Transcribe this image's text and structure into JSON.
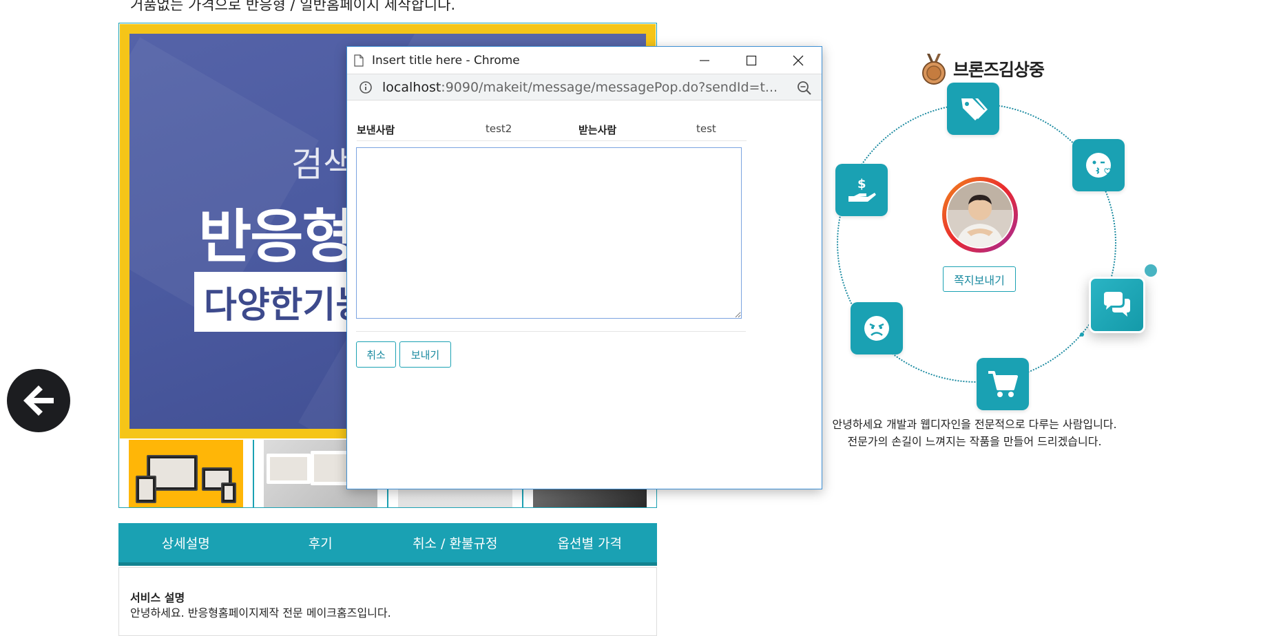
{
  "page": {
    "top_text": "거품없는 가격으로 반응형 / 일반홈페이지 제작합니다.",
    "hero": {
      "line1": "검색",
      "line2": "반응형",
      "line3": "다양한기능"
    },
    "nav": [
      "상세설명",
      "후기",
      "취소 / 환불규정",
      "옵션별 가격"
    ],
    "service_title": "서비스 설명",
    "service_text": "안녕하세요. 반응형홈페이지제작 전문 메이크홈즈입니다."
  },
  "profile": {
    "seller_name": "브론즈김상중",
    "send_message_label": "쪽지보내기",
    "intro_line1": "안녕하세요 개발과 웹디자인을 전문적으로 다루는 사람입니다.",
    "intro_line2": "전문가의 손길이 느껴지는 작품을 만들어 드리겠습니다.",
    "accent_color": "#1aa1b3"
  },
  "popup": {
    "window_title": "Insert title here - Chrome",
    "url_host": "localhost",
    "url_rest": ":9090/makeit/message/messagePop.do?sendId=t...",
    "sender_label": "보낸사람",
    "sender_value": "test2",
    "receiver_label": "받는사람",
    "receiver_value": "test",
    "message_value": "",
    "cancel_label": "취소",
    "send_label": "보내기"
  }
}
